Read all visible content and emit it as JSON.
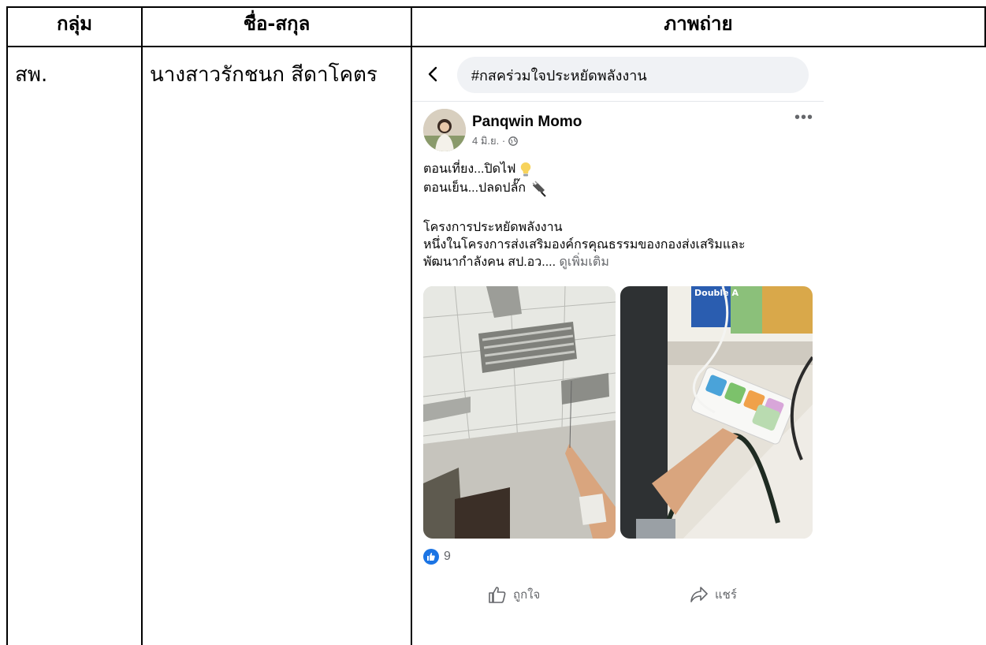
{
  "table": {
    "headers": [
      "กลุ่ม",
      "ชื่อ-สกุล",
      "ภาพถ่าย"
    ],
    "row": {
      "group": "สพ.",
      "name": "นางสาวรักชนก สีดาโคตร"
    }
  },
  "post": {
    "search_text": "#กสคร่วมใจประหยัดพลังงาน",
    "author": "Panqwin Momo",
    "date": "4 มิ.ย. ·",
    "more": "•••",
    "lines": [
      "ตอนเที่ยง...ปิดไฟ",
      "ตอนเย็น...ปลดปลั๊ก"
    ],
    "body_lines": [
      "โครงการประหยัดพลังงาน",
      "หนึ่งในโครงการส่งเสริมองค์กรคุณธรรมของกองส่งเสริมและ"
    ],
    "last_line": "พัฒนากำลังคน สป.อว....",
    "see_more": "ดูเพิ่มเติม",
    "photo_label": "Double A",
    "likes": "9",
    "like_label": "ถูกใจ",
    "share_label": "แชร์",
    "colors": {
      "like_blue": "#1b74e4",
      "muted": "#65676b",
      "pill_bg": "#f0f2f5"
    }
  }
}
